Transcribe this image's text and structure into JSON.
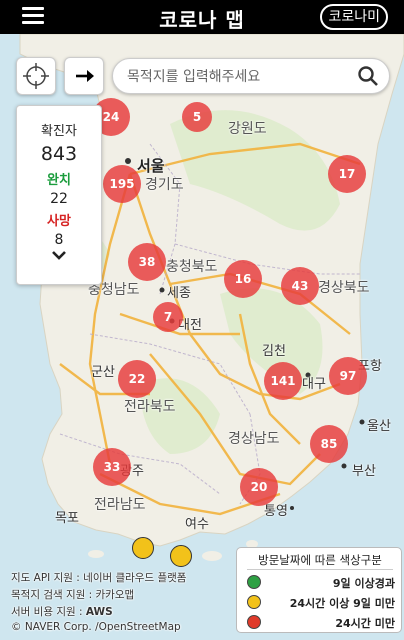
{
  "header": {
    "title": "코로나 맵",
    "menu_icon": "hamburger-menu-icon",
    "corona_button_label": "코로나미"
  },
  "controls": {
    "locate_icon": "crosshair-icon",
    "route_icon": "arrow-right-icon",
    "search_placeholder": "목적지를 입력해주세요",
    "search_icon": "search-icon"
  },
  "stats": {
    "confirmed_label": "확진자",
    "confirmed_value": "843",
    "recovered_label": "완치",
    "recovered_value": "22",
    "deaths_label": "사망",
    "deaths_value": "8",
    "expand_icon": "chevron-down-icon",
    "colors": {
      "recovered": "#1a9c3c",
      "deaths": "#d62222"
    }
  },
  "map": {
    "labels": {
      "seoul": "서울",
      "gangwon": "강원도",
      "gyeonggi": "경기도",
      "chungbuk": "충청북도",
      "chungnam": "충청남도",
      "sejong": "세종",
      "daejeon": "대전",
      "gyeongbuk": "경상북도",
      "gimcheon": "김천",
      "pohang": "포항",
      "gunsan": "군산",
      "jeonbuk": "전라북도",
      "daegu": "대구",
      "gyeongnam": "경상남도",
      "ulsan": "울산",
      "busan": "부산",
      "gwangju": "광주",
      "jeonnam": "전라남도",
      "mokpo": "목포",
      "yeosu": "여수",
      "tongyeong": "통영"
    },
    "clusters": [
      {
        "value": "24"
      },
      {
        "value": "5"
      },
      {
        "value": "195"
      },
      {
        "value": "17"
      },
      {
        "value": "38"
      },
      {
        "value": "16"
      },
      {
        "value": "43"
      },
      {
        "value": "7"
      },
      {
        "value": "141"
      },
      {
        "value": "97"
      },
      {
        "value": "22"
      },
      {
        "value": "85"
      },
      {
        "value": "33"
      },
      {
        "value": "20"
      }
    ],
    "cluster_color": "#e63a3a",
    "markers_color": "#f2c21a"
  },
  "attribution": {
    "map_api_label": "지도 API 지원 :",
    "map_api_value": "네이버 클라우드 플랫폼",
    "search_label": "목적지 검색 지원 :",
    "search_value": "카카오맵",
    "server_label": "서버 비용 지원 :",
    "server_value": "AWS",
    "copyright": "© NAVER Corp. /OpenStreetMap"
  },
  "legend": {
    "title": "방문날짜에 따른 색상구분",
    "items": [
      {
        "label": "9일 이상경과",
        "color": "#2ea043"
      },
      {
        "label": "24시간 이상 9일 미만",
        "color": "#f2c21a"
      },
      {
        "label": "24시간 미만",
        "color": "#e03a2a"
      }
    ]
  }
}
